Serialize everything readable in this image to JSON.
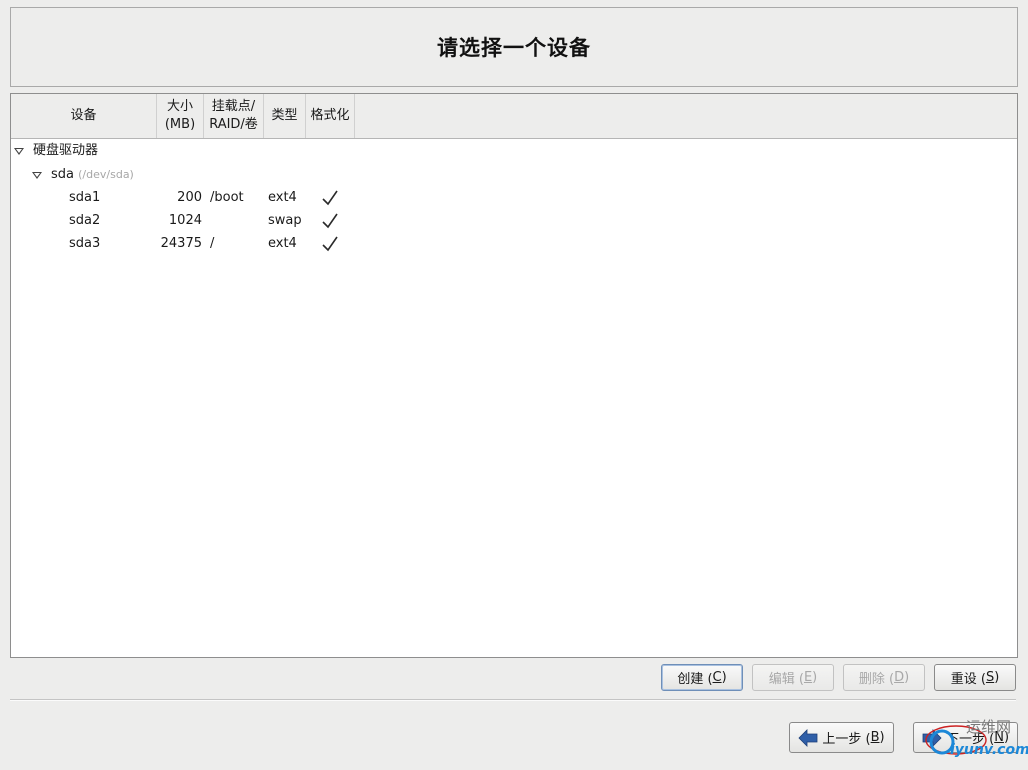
{
  "header": {
    "title": "请选择一个设备"
  },
  "table": {
    "columns": {
      "device": "设备",
      "size_line1": "大小",
      "size_line2": "(MB)",
      "mount_line1": "挂载点/",
      "mount_line2": "RAID/卷",
      "type": "类型",
      "format": "格式化"
    },
    "group": {
      "label": "硬盘驱动器"
    },
    "disk": {
      "name": "sda",
      "path": "(/dev/sda)"
    },
    "partitions": [
      {
        "name": "sda1",
        "size": "200",
        "mount": "/boot",
        "type": "ext4",
        "format": true
      },
      {
        "name": "sda2",
        "size": "1024",
        "mount": "",
        "type": "swap",
        "format": true
      },
      {
        "name": "sda3",
        "size": "24375",
        "mount": "/",
        "type": "ext4",
        "format": true
      }
    ]
  },
  "actions": {
    "create": {
      "label": "创建 (",
      "key": "C",
      "end": ")"
    },
    "edit": {
      "label": "编辑 (",
      "key": "E",
      "end": ")"
    },
    "delete": {
      "label": "删除 (",
      "key": "D",
      "end": ")"
    },
    "reset": {
      "label": "重设 (",
      "key": "S",
      "end": ")"
    }
  },
  "nav": {
    "back": {
      "label": "上一步 (",
      "key": "B",
      "end": ")"
    },
    "next": {
      "label": "下一步 (",
      "key": "N",
      "end": ")"
    }
  },
  "watermark": {
    "line1": "运维网",
    "line2": "iyunv.com"
  },
  "colors": {
    "arrow_blue": "#2f5fa8",
    "watermark_red": "#cc2222",
    "watermark_blue": "#1c88d8"
  }
}
